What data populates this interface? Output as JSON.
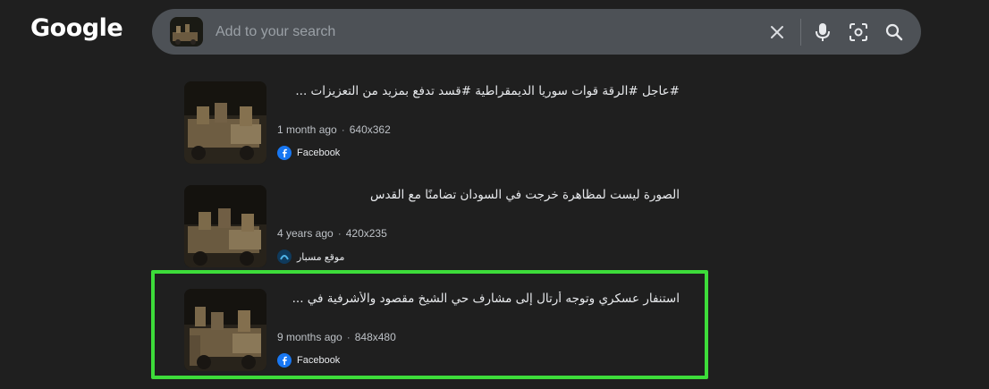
{
  "app": {
    "logo_text": "Google"
  },
  "search": {
    "placeholder": "Add to your search",
    "query_image": "query-image-thumbnail",
    "icons": [
      "close-icon",
      "mic-icon",
      "lens-icon",
      "search-icon"
    ]
  },
  "results": [
    {
      "title": "#عاجل #الرقة قوات سوريا الديمقراطية #قسد تدفع بمزيد من التعزيزات ...",
      "age": "1 month ago",
      "size": "640x362",
      "source": "Facebook",
      "source_icon": "facebook-icon"
    },
    {
      "title": "الصورة ليست لمظاهرة خرجت في السودان تضامنًا مع القدس",
      "age": "4 years ago",
      "size": "420x235",
      "source": "موقع مسبار",
      "source_icon": "misbar-icon"
    },
    {
      "title": "استنفار عسكري وتوجه أرتال إلى مشارف حي الشيخ مقصود والأشرفية في ...",
      "age": "9 months ago",
      "size": "848x480",
      "source": "Facebook",
      "source_icon": "facebook-icon"
    }
  ],
  "highlight": {
    "color": "#3ddc3a",
    "target_result": 3
  },
  "colors": {
    "background": "#1f1f1f",
    "searchbar": "#4d5156",
    "text": "#e8eaed",
    "meta": "#bdc1c6",
    "facebook": "#1877f2"
  }
}
